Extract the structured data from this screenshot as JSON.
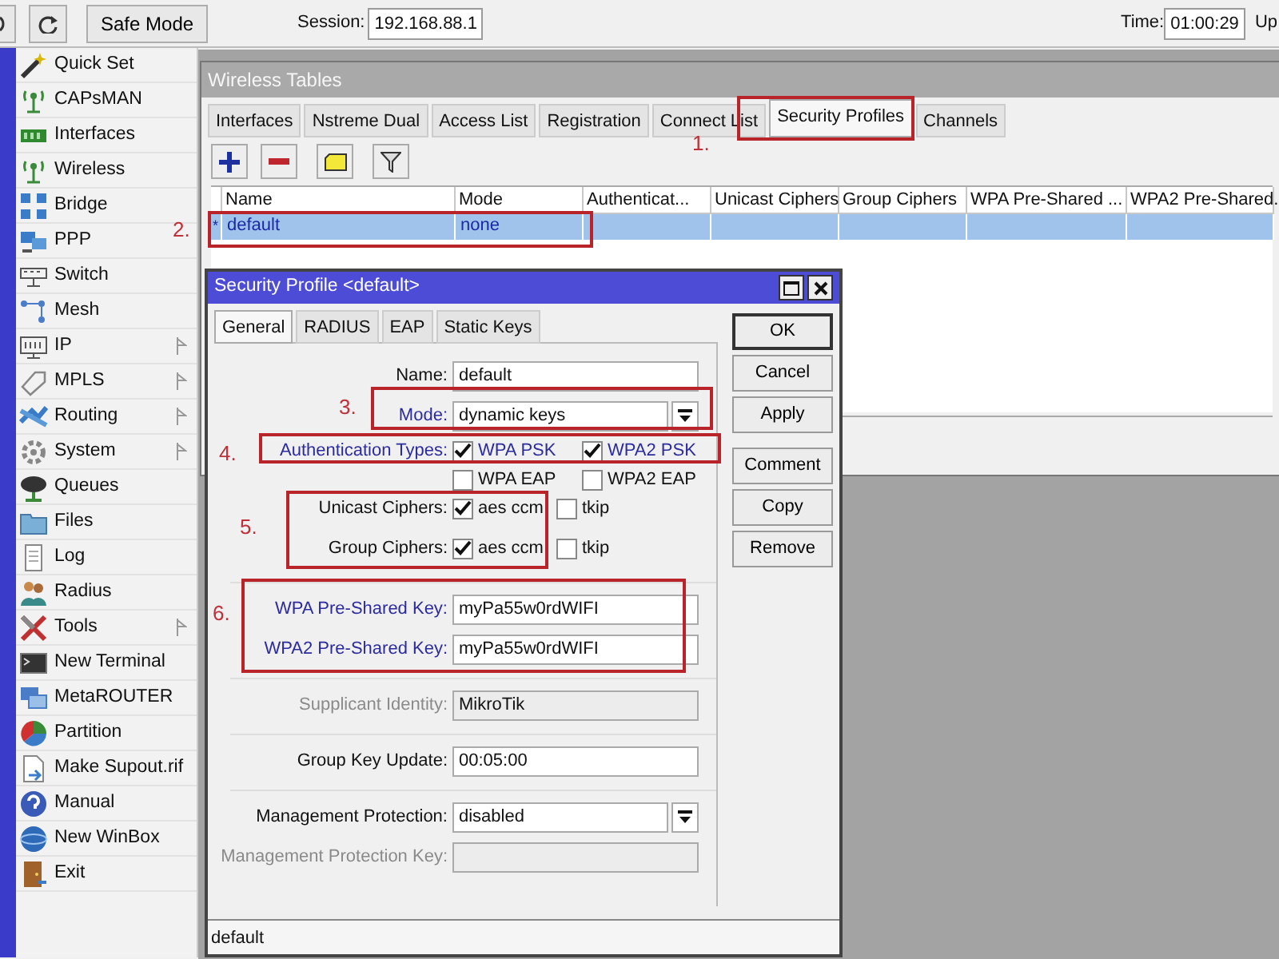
{
  "toolbar": {
    "safe_mode": "Safe Mode",
    "session_label": "Session:",
    "session_value": "192.168.88.1",
    "time_label": "Time:",
    "time_value": "01:00:29",
    "cut_label": "Up"
  },
  "sidebar": {
    "items": [
      {
        "label": "Quick Set",
        "submenu": false
      },
      {
        "label": "CAPsMAN",
        "submenu": false
      },
      {
        "label": "Interfaces",
        "submenu": false
      },
      {
        "label": "Wireless",
        "submenu": false
      },
      {
        "label": "Bridge",
        "submenu": false
      },
      {
        "label": "PPP",
        "submenu": false
      },
      {
        "label": "Switch",
        "submenu": false
      },
      {
        "label": "Mesh",
        "submenu": false
      },
      {
        "label": "IP",
        "submenu": true
      },
      {
        "label": "MPLS",
        "submenu": true
      },
      {
        "label": "Routing",
        "submenu": true
      },
      {
        "label": "System",
        "submenu": true
      },
      {
        "label": "Queues",
        "submenu": false
      },
      {
        "label": "Files",
        "submenu": false
      },
      {
        "label": "Log",
        "submenu": false
      },
      {
        "label": "Radius",
        "submenu": false
      },
      {
        "label": "Tools",
        "submenu": true
      },
      {
        "label": "New Terminal",
        "submenu": false
      },
      {
        "label": "MetaROUTER",
        "submenu": false
      },
      {
        "label": "Partition",
        "submenu": false
      },
      {
        "label": "Make Supout.rif",
        "submenu": false
      },
      {
        "label": "Manual",
        "submenu": false
      },
      {
        "label": "New WinBox",
        "submenu": false
      },
      {
        "label": "Exit",
        "submenu": false
      }
    ]
  },
  "wireless_tables": {
    "title": "Wireless Tables",
    "tabs": [
      {
        "label": "Interfaces",
        "selected": false
      },
      {
        "label": "Nstreme Dual",
        "selected": false
      },
      {
        "label": "Access List",
        "selected": false
      },
      {
        "label": "Registration",
        "selected": false
      },
      {
        "label": "Connect List",
        "selected": false
      },
      {
        "label": "Security Profiles",
        "selected": true
      },
      {
        "label": "Channels",
        "selected": false
      }
    ],
    "columns": [
      "Name",
      "Mode",
      "Authenticat...",
      "Unicast Ciphers",
      "Group Ciphers",
      "WPA Pre-Shared ...",
      "WPA2 Pre-Shared."
    ],
    "rows": [
      {
        "marker": "*",
        "cells": [
          "default",
          "none"
        ],
        "selected": true
      }
    ]
  },
  "dialog": {
    "title": "Security Profile <default>",
    "tabs": [
      {
        "label": "General",
        "selected": true
      },
      {
        "label": "RADIUS",
        "selected": false
      },
      {
        "label": "EAP",
        "selected": false
      },
      {
        "label": "Static Keys",
        "selected": false
      }
    ],
    "fields": [
      {
        "kind": "text",
        "label": "Name:",
        "value": "default",
        "modified": false,
        "disabled": false,
        "divider": false
      },
      {
        "kind": "select",
        "label": "Mode:",
        "value": "dynamic keys",
        "modified": true,
        "disabled": false,
        "divider": false
      },
      {
        "kind": "checks",
        "label": "Authentication Types:",
        "modified": true,
        "disabled": false,
        "divider": false,
        "options": [
          {
            "label": "WPA PSK",
            "checked": true
          },
          {
            "label": "WPA2 PSK",
            "checked": true
          },
          {
            "label": "WPA EAP",
            "checked": false
          },
          {
            "label": "WPA2 EAP",
            "checked": false
          }
        ]
      },
      {
        "kind": "checks",
        "label": "Unicast Ciphers:",
        "modified": false,
        "disabled": false,
        "divider": false,
        "options": [
          {
            "label": "aes ccm",
            "checked": true
          },
          {
            "label": "tkip",
            "checked": false
          }
        ]
      },
      {
        "kind": "checks",
        "label": "Group Ciphers:",
        "modified": false,
        "disabled": false,
        "divider": false,
        "options": [
          {
            "label": "aes ccm",
            "checked": true
          },
          {
            "label": "tkip",
            "checked": false
          }
        ]
      },
      {
        "kind": "text",
        "label": "WPA Pre-Shared Key:",
        "value": "myPa55w0rdWIFI",
        "modified": true,
        "disabled": false,
        "divider": true
      },
      {
        "kind": "text",
        "label": "WPA2 Pre-Shared Key:",
        "value": "myPa55w0rdWIFI",
        "modified": true,
        "disabled": false,
        "divider": false
      },
      {
        "kind": "text",
        "label": "Supplicant Identity:",
        "value": "MikroTik",
        "modified": false,
        "disabled": true,
        "divider": true
      },
      {
        "kind": "text",
        "label": "Group Key Update:",
        "value": "00:05:00",
        "modified": false,
        "disabled": false,
        "divider": true
      },
      {
        "kind": "select",
        "label": "Management Protection:",
        "value": "disabled",
        "modified": false,
        "disabled": false,
        "divider": true
      },
      {
        "kind": "text",
        "label": "Management Protection Key:",
        "modified": false,
        "disabled": true,
        "divider": false
      }
    ],
    "buttons": [
      {
        "label": "OK",
        "default": true
      },
      {
        "label": "Cancel",
        "default": false
      },
      {
        "label": "Apply",
        "default": false
      },
      {
        "label": "Comment",
        "default": false
      },
      {
        "label": "Copy",
        "default": false
      },
      {
        "label": "Remove",
        "default": false
      }
    ],
    "status": "default"
  },
  "annotations": [
    {
      "label": "1."
    },
    {
      "label": "2."
    },
    {
      "label": "3."
    },
    {
      "label": "4."
    },
    {
      "label": "5."
    },
    {
      "label": "6."
    }
  ]
}
